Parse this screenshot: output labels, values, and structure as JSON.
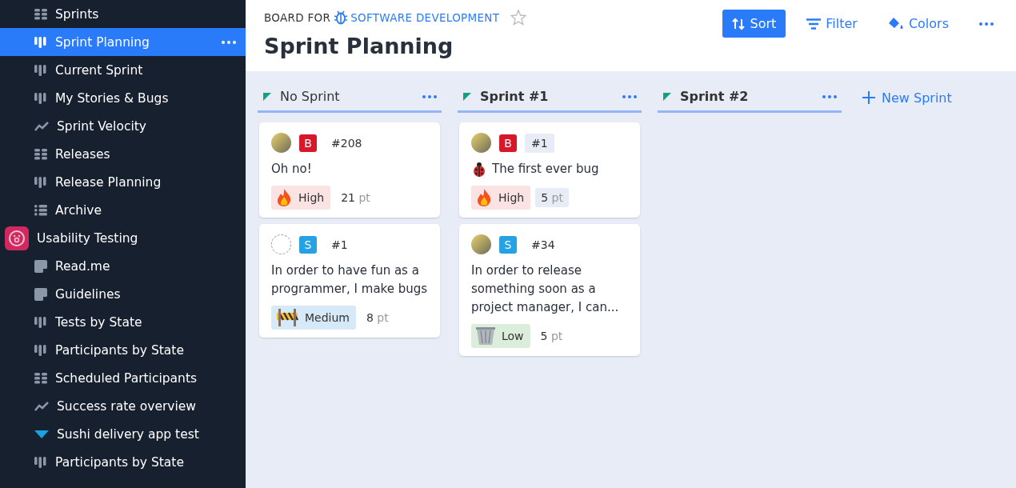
{
  "sidebar": {
    "items": [
      {
        "label": "Sprints",
        "kind": "table",
        "selected": false
      },
      {
        "label": "Sprint Planning",
        "kind": "board",
        "selected": true
      },
      {
        "label": "Current Sprint",
        "kind": "board",
        "selected": false
      },
      {
        "label": "My Stories & Bugs",
        "kind": "board",
        "selected": false
      },
      {
        "label": "Sprint Velocity",
        "kind": "chart",
        "selected": false
      },
      {
        "label": "Releases",
        "kind": "table",
        "selected": false
      },
      {
        "label": "Release Planning",
        "kind": "board",
        "selected": false
      },
      {
        "label": "Archive",
        "kind": "list",
        "selected": false
      },
      {
        "label": "Usability Testing",
        "kind": "project",
        "selected": false,
        "children": [
          {
            "label": "Read.me",
            "kind": "doc",
            "selected": false
          },
          {
            "label": "Guidelines",
            "kind": "doc",
            "selected": false
          },
          {
            "label": "Tests by State",
            "kind": "board",
            "selected": false
          },
          {
            "label": "Participants by State",
            "kind": "board",
            "selected": false
          },
          {
            "label": "Scheduled Participants",
            "kind": "table",
            "selected": false
          },
          {
            "label": "Success rate overview",
            "kind": "chart",
            "selected": false
          },
          {
            "label": "Sushi delivery app test",
            "kind": "folder",
            "selected": false,
            "expanded": true,
            "children": [
              {
                "label": "Participants by State",
                "kind": "board",
                "selected": false
              }
            ]
          }
        ]
      }
    ]
  },
  "header": {
    "board_for": "BOARD FOR",
    "project": "SOFTWARE DEVELOPMENT",
    "title": "Sprint Planning",
    "starred": false,
    "actions": [
      {
        "label": "Sort",
        "kind": "primary"
      },
      {
        "label": "Filter",
        "kind": "filter"
      },
      {
        "label": "Colors",
        "kind": "colors"
      }
    ]
  },
  "columns": [
    {
      "title": "No Sprint",
      "kind": "backlog",
      "cards": [
        {
          "avatar": {
            "kind": "photo"
          },
          "type": {
            "label": "B",
            "color": "#d7182a"
          },
          "number": "#208",
          "number_highlighted": false,
          "title": "Oh no!",
          "priority": {
            "label": "High",
            "kind": "high"
          },
          "points": "21",
          "points_unit": "pt",
          "points_highlighted": false
        },
        {
          "avatar": {
            "kind": "none"
          },
          "type": {
            "label": "S",
            "color": "#26a1e4"
          },
          "number": "#1",
          "number_highlighted": false,
          "title": "In order to have fun as a programmer, I make bugs",
          "priority": {
            "label": "Medium",
            "kind": "medium"
          },
          "points": "8",
          "points_unit": "pt",
          "points_highlighted": false
        }
      ]
    },
    {
      "title": "Sprint #1",
      "kind": "sprint",
      "cards": [
        {
          "avatar": {
            "kind": "photo"
          },
          "type": {
            "label": "B",
            "color": "#d7182a"
          },
          "number": "#1",
          "number_highlighted": true,
          "title_icon": {
            "kind": "ladybug"
          },
          "title": "The first ever bug",
          "priority": {
            "label": "High",
            "kind": "high"
          },
          "points": "5",
          "points_unit": "pt",
          "points_highlighted": true
        },
        {
          "avatar": {
            "kind": "photo"
          },
          "type": {
            "label": "S",
            "color": "#26a1e4"
          },
          "number": "#34",
          "number_highlighted": false,
          "title": "In order to release something soon as a project manager, I can...",
          "priority": {
            "label": "Low",
            "kind": "low"
          },
          "points": "5",
          "points_unit": "pt",
          "points_highlighted": false
        }
      ]
    },
    {
      "title": "Sprint #2",
      "kind": "sprint"
    }
  ],
  "new_sprint": "New Sprint"
}
